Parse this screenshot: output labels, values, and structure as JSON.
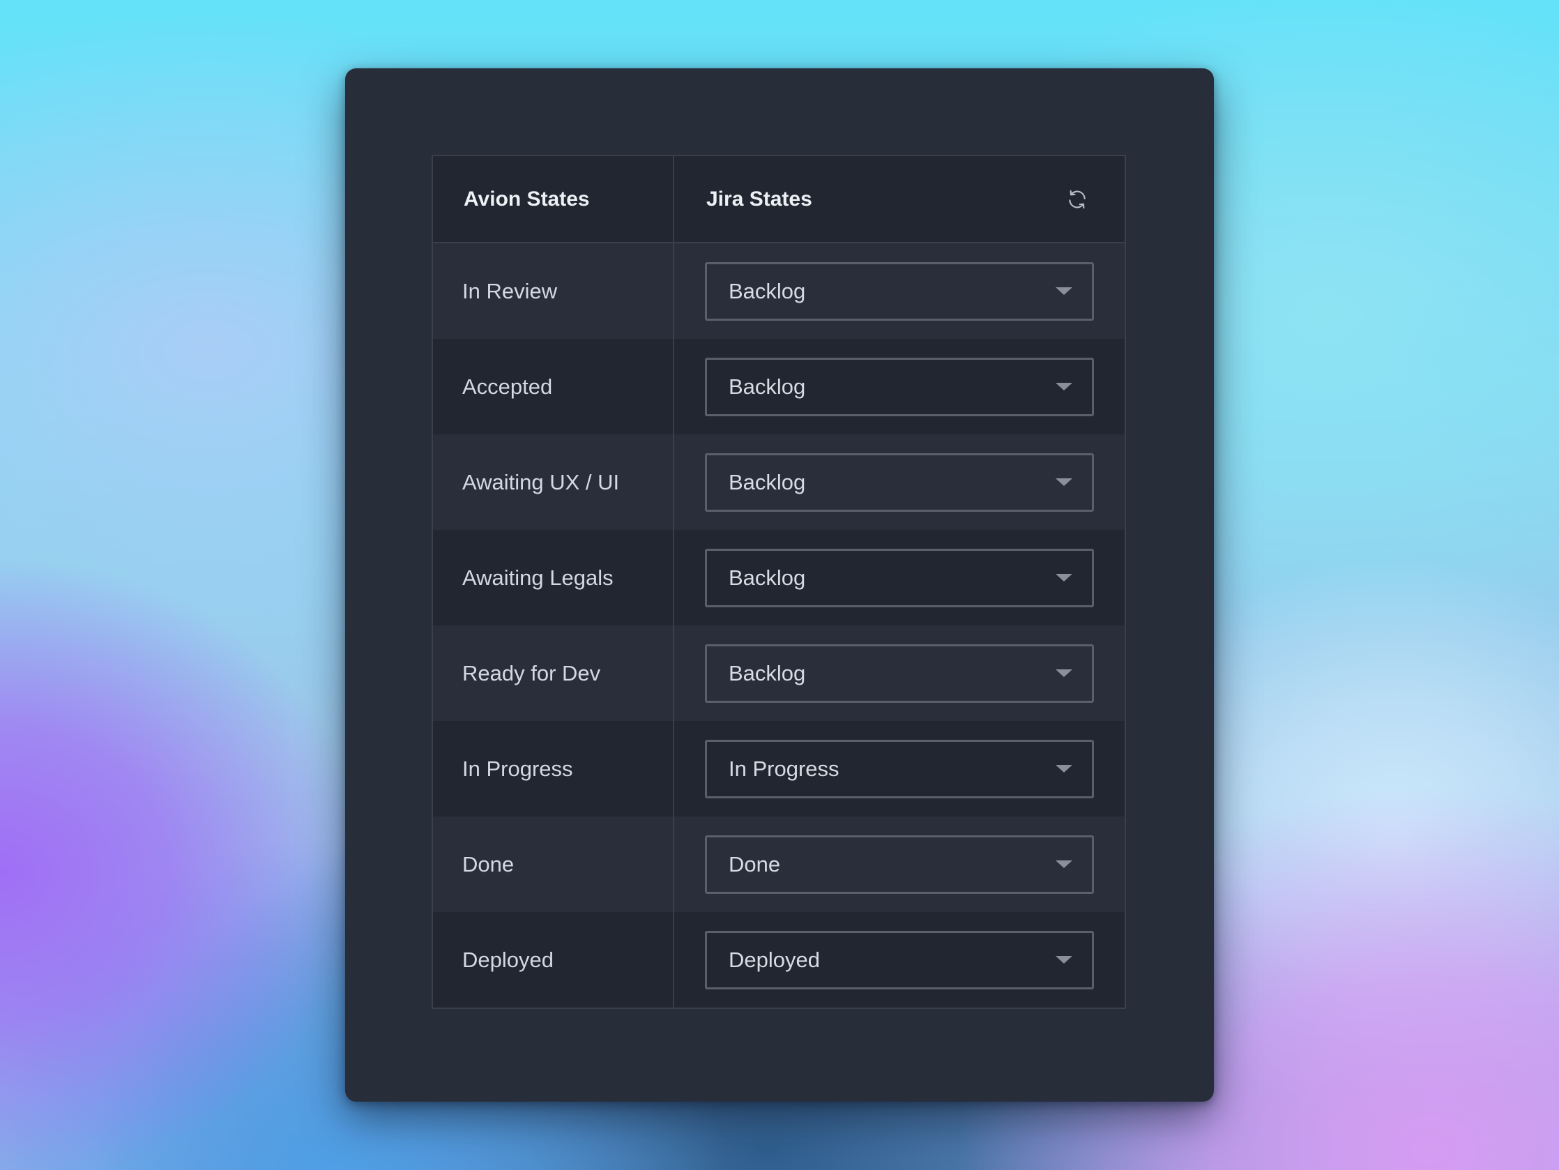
{
  "table": {
    "headers": {
      "avion": "Avion States",
      "jira": "Jira States"
    },
    "rows": [
      {
        "avion_state": "In Review",
        "jira_state": "Backlog"
      },
      {
        "avion_state": "Accepted",
        "jira_state": "Backlog"
      },
      {
        "avion_state": "Awaiting UX / UI",
        "jira_state": "Backlog"
      },
      {
        "avion_state": "Awaiting Legals",
        "jira_state": "Backlog"
      },
      {
        "avion_state": "Ready for Dev",
        "jira_state": "Backlog"
      },
      {
        "avion_state": "In Progress",
        "jira_state": "In Progress"
      },
      {
        "avion_state": "Done",
        "jira_state": "Done"
      },
      {
        "avion_state": "Deployed",
        "jira_state": "Deployed"
      }
    ]
  },
  "icons": {
    "refresh": "refresh-icon",
    "dropdown": "chevron-down-icon"
  },
  "colors": {
    "card_background": "#282d3a",
    "row_odd": "#2a2e3b",
    "row_even": "#222630",
    "border": "#3a3f4c",
    "select_border": "#5a5f6b",
    "text": "#d4d8e2"
  }
}
